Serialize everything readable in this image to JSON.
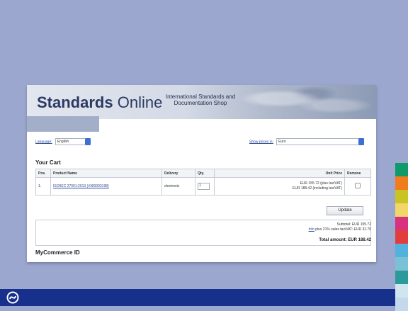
{
  "site": {
    "title_bold": "Standards",
    "title_light": "Online",
    "tagline": "International Standards and Documentation Shop"
  },
  "preferences": {
    "language_label": "Language:",
    "language_value": "English",
    "prices_label": "Show prices in:",
    "currency_value": "Euro"
  },
  "cart": {
    "heading": "Your Cart",
    "columns": [
      "Pos.",
      "Product Name",
      "Delivery",
      "Qty.",
      "Unit Price",
      "Remove"
    ],
    "rows": [
      {
        "pos": "1.",
        "product": "ISO/IEC 27001:2013 (#300003198)",
        "delivery": "electronic",
        "qty": "1",
        "price_net": "EUR 155.72 (plus tax/VAT)",
        "price_gross": "EUR 188.42 (including tax/VAT)"
      }
    ],
    "update_label": "Update",
    "subtotal": "Subtotal: EUR 155.72",
    "tax_link": "Info",
    "tax_text": "plus 21% sales tax/VAT: EUR 32.70",
    "total": "Total amount: EUR 188.42"
  },
  "next_section": "MyCommerce ID",
  "colors": {
    "slide_background": "#9ba7cf",
    "footer_bar": "#17308c",
    "strip": [
      "#0f9a6a",
      "#f07c1e",
      "#c9c423",
      "#f3d66a",
      "#d8317d",
      "#e23c3c",
      "#52b2de",
      "#7ac1d6",
      "#2b9a9a",
      "#cfe6ef",
      "#c5d9ec"
    ]
  }
}
